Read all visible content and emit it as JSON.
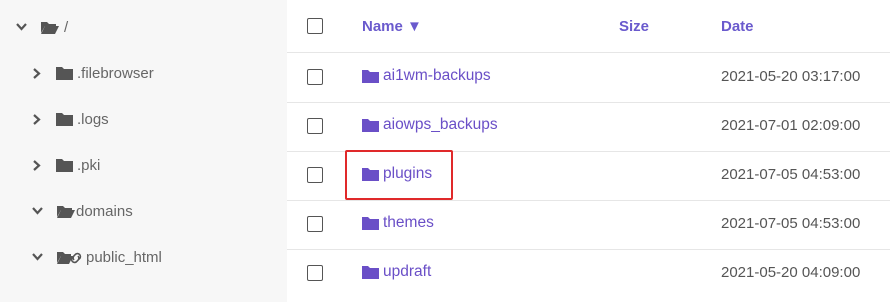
{
  "colors": {
    "accent": "#6a4fc7",
    "highlight": "#e0292a",
    "folder": "#555555"
  },
  "sidebar": {
    "items": [
      {
        "label": "/",
        "icon": "folder-open-icon",
        "expanded": true
      },
      {
        "label": ".filebrowser",
        "icon": "folder-icon",
        "expanded": false
      },
      {
        "label": ".logs",
        "icon": "folder-icon",
        "expanded": false
      },
      {
        "label": ".pki",
        "icon": "folder-icon",
        "expanded": false
      },
      {
        "label": "domains",
        "icon": "folder-open-icon",
        "expanded": true
      },
      {
        "label": "public_html",
        "icon": "folder-link-icon",
        "expanded": true
      }
    ]
  },
  "table": {
    "columns": {
      "name": "Name ▼",
      "size": "Size",
      "date": "Date"
    },
    "rows": [
      {
        "name": "ai1wm-backups",
        "size": "",
        "date": "2021-05-20 03:17:00"
      },
      {
        "name": "aiowps_backups",
        "size": "",
        "date": "2021-07-01 02:09:00"
      },
      {
        "name": "plugins",
        "size": "",
        "date": "2021-07-05 04:53:00"
      },
      {
        "name": "themes",
        "size": "",
        "date": "2021-07-05 04:53:00"
      },
      {
        "name": "updraft",
        "size": "",
        "date": "2021-05-20 04:09:00"
      }
    ]
  }
}
